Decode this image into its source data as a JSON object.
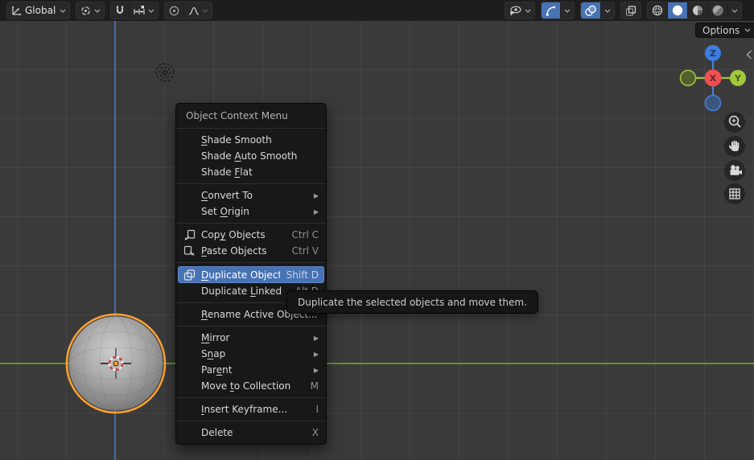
{
  "header": {
    "orientation_label": "Global",
    "left_icons": [
      "transform-orientation-icon",
      "pivot-point-icon",
      "snap-magnet-icon",
      "snap-target-icon",
      "proportional-editing-icon",
      "falloff-curve-icon"
    ],
    "right_icons": [
      "object-visibility-icon",
      "gizmos-icon",
      "overlays-icon",
      "xray-icon",
      "shading-wireframe-icon",
      "shading-solid-icon",
      "shading-material-icon",
      "shading-rendered-icon"
    ]
  },
  "viewport": {
    "options_label": "Options",
    "nav_tools": [
      "zoom-icon",
      "pan-hand-icon",
      "camera-view-icon",
      "grid-ortho-icon"
    ]
  },
  "gizmo": {
    "x_label": "X",
    "y_label": "Y",
    "z_label": "Z"
  },
  "context_menu": {
    "title": "Object Context Menu",
    "sections": [
      {
        "items": [
          {
            "pre": "",
            "accel": "S",
            "post": "hade Smooth"
          },
          {
            "pre": "Shade ",
            "accel": "A",
            "post": "uto Smooth"
          },
          {
            "pre": "Shade ",
            "accel": "F",
            "post": "lat"
          }
        ]
      },
      {
        "items": [
          {
            "pre": "",
            "accel": "C",
            "post": "onvert To",
            "submenu": true
          },
          {
            "pre": "Set ",
            "accel": "O",
            "post": "rigin",
            "submenu": true
          }
        ]
      },
      {
        "items": [
          {
            "pre": "Cop",
            "accel": "y",
            "post": " Objects",
            "icon": "copy-icon",
            "shortcut": "Ctrl C"
          },
          {
            "pre": "",
            "accel": "P",
            "post": "aste Objects",
            "icon": "paste-icon",
            "shortcut": "Ctrl V"
          }
        ]
      },
      {
        "items": [
          {
            "pre": "",
            "accel": "D",
            "post": "uplicate Objects",
            "icon": "duplicate-icon",
            "shortcut": "Shift D",
            "highlighted": true
          },
          {
            "pre": "Duplicate ",
            "accel": "L",
            "post": "inked",
            "shortcut": "Alt D"
          }
        ]
      },
      {
        "items": [
          {
            "pre": "",
            "accel": "R",
            "post": "ename Active Object..."
          }
        ]
      },
      {
        "items": [
          {
            "pre": "",
            "accel": "M",
            "post": "irror",
            "submenu": true
          },
          {
            "pre": "S",
            "accel": "n",
            "post": "ap",
            "submenu": true
          },
          {
            "pre": "Par",
            "accel": "e",
            "post": "nt",
            "submenu": true
          },
          {
            "pre": "Move ",
            "accel": "t",
            "post": "o Collection",
            "shortcut": "M"
          }
        ]
      },
      {
        "items": [
          {
            "pre": "",
            "accel": "I",
            "post": "nsert Keyframe...",
            "shortcut": "I"
          }
        ]
      },
      {
        "items": [
          {
            "pre": "Delete",
            "accel": "",
            "post": "",
            "shortcut": "X"
          }
        ]
      }
    ]
  },
  "tooltip": {
    "text": "Duplicate the selected objects and move them."
  },
  "colors": {
    "accent_blue": "#4772B3",
    "selection_outline_orange": "#FFA133",
    "axis_green": "#6CA236",
    "axis_blue": "#4A72B8",
    "gizmo_x_red": "#EF5050",
    "gizmo_y_green": "#A2C93C",
    "gizmo_z_blue": "#3F7DE0",
    "menu_bg": "#181818",
    "header_bg": "#1D1D1D"
  }
}
